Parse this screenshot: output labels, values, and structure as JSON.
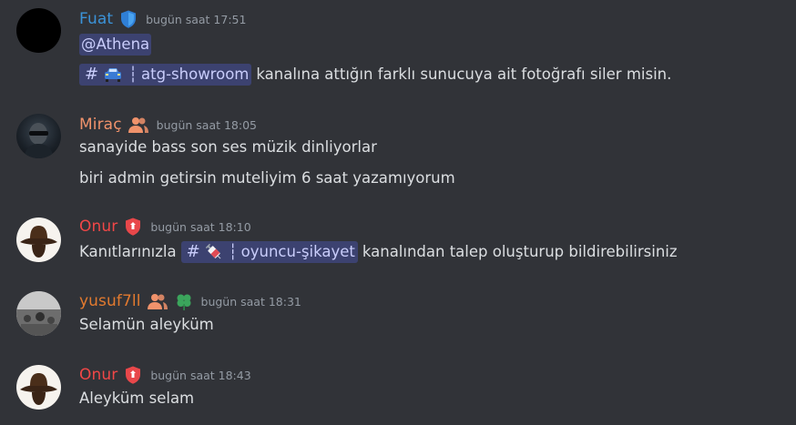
{
  "colors": {
    "background": "#313338",
    "fuat": "#3b93d9",
    "mirac": "#f0926b",
    "onur": "#f04747",
    "yusuf": "#e27a2f",
    "mention_bg": "#3c4270",
    "mention_text": "#c9cdfb",
    "timestamp": "#949ba4"
  },
  "messages": [
    {
      "username": "Fuat",
      "timestamp": "bugün saat 17:51",
      "role_icon": "shield-icon",
      "mention": "@Athena",
      "channel_name": "atg-showroom",
      "channel_emoji": "car-icon",
      "channel_separator": "┆",
      "text_after": "kanalına attığın farklı sunucuya ait fotoğrafı siler misin."
    },
    {
      "username": "Miraç",
      "timestamp": "bugün saat 18:05",
      "role_icon": "members-icon",
      "lines": [
        "sanayide bass son ses müzik dinliyorlar",
        "biri admin getirsin muteliyim 6 saat yazamıyorum"
      ]
    },
    {
      "username": "Onur",
      "timestamp": "bugün saat 18:10",
      "role_icon": "mod-shield-icon",
      "text_before": "Kanıtlarınızla",
      "channel_name": "oyuncu-şikayet",
      "channel_emoji": "syringe-icon",
      "channel_separator": "┆",
      "text_after": "kanalından talep oluşturup bildirebilirsiniz"
    },
    {
      "username": "yusuf7ll",
      "timestamp": "bugün saat 18:31",
      "role_icon": "members-icon",
      "role_icon_2": "clover-icon",
      "text": "Selamün aleyküm"
    },
    {
      "username": "Onur",
      "timestamp": "bugün saat 18:43",
      "role_icon": "mod-shield-icon",
      "text": "Aleyküm selam"
    }
  ]
}
